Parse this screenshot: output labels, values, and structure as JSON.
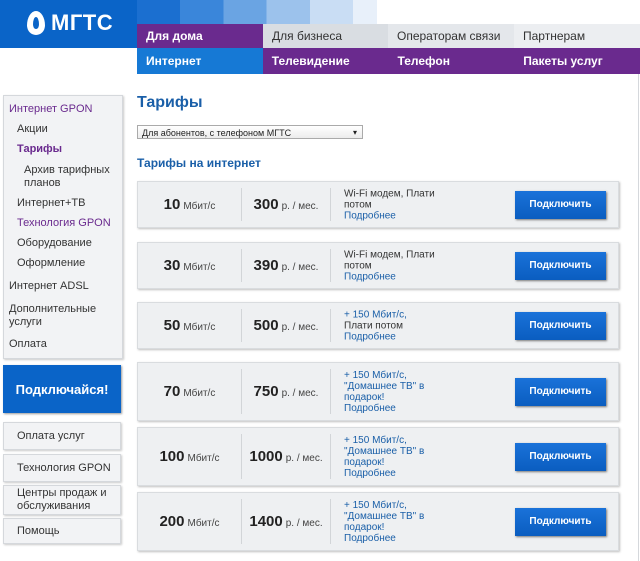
{
  "logo": {
    "text": "МГТС"
  },
  "top_nav": [
    "Для дома",
    "Для бизнеса",
    "Операторам связи",
    "Партнерам"
  ],
  "sub_nav": [
    "Интернет",
    "Телевидение",
    "Телефон",
    "Пакеты услуг"
  ],
  "sidebar": {
    "items": [
      "Интернет GPON",
      "Акции",
      "Тарифы",
      "Архив тарифных планов",
      "Интернет+ТВ",
      "Технология GPON",
      "Оборудование",
      "Оформление",
      "Интернет ADSL",
      "Дополнительные услуги",
      "Оплата"
    ],
    "cta": "Подключайся!",
    "buttons": [
      "Оплата услуг",
      "Технология GPON",
      "Центры продаж и обслуживания",
      "Помощь"
    ]
  },
  "main": {
    "title": "Тарифы",
    "select_value": "Для абонентов, с телефоном МГТС",
    "subtitle": "Тарифы на интернет",
    "connect_label": "Подключить",
    "tariffs": [
      {
        "speed": "10",
        "speed_unit": "Мбит/с",
        "price": "300",
        "price_unit": "р. / мес.",
        "features": "Wi-Fi модем, Плати потом",
        "more": "Подробнее"
      },
      {
        "speed": "30",
        "speed_unit": "Мбит/с",
        "price": "390",
        "price_unit": "р. / мес.",
        "features": "Wi-Fi модем, Плати потом",
        "more": "Подробнее"
      },
      {
        "speed": "50",
        "speed_unit": "Мбит/с",
        "price": "500",
        "price_unit": "р. / мес.",
        "bonus": "+ 150 Мбит/с,",
        "features": "Плати потом",
        "more": "Подробнее"
      },
      {
        "speed": "70",
        "speed_unit": "Мбит/с",
        "price": "750",
        "price_unit": "р. / мес.",
        "bonus": "+ 150 Мбит/с, \"Домашнее ТВ\" в подарок!",
        "more": "Подробнее"
      },
      {
        "speed": "100",
        "speed_unit": "Мбит/с",
        "price": "1000",
        "price_unit": "р. / мес.",
        "bonus": "+ 150 Мбит/с, \"Домашнее ТВ\" в подарок!",
        "more": "Подробнее"
      },
      {
        "speed": "200",
        "speed_unit": "Мбит/с",
        "price": "1400",
        "price_unit": "р. / мес.",
        "bonus": "+ 150 Мбит/с, \"Домашнее ТВ\" в подарок!",
        "more": "Подробнее"
      }
    ]
  },
  "colors": {
    "brand_blue": "#0a64c8",
    "purple": "#6a2a8e",
    "active_tab": "#1679d5",
    "link_blue": "#1a5fa8"
  }
}
